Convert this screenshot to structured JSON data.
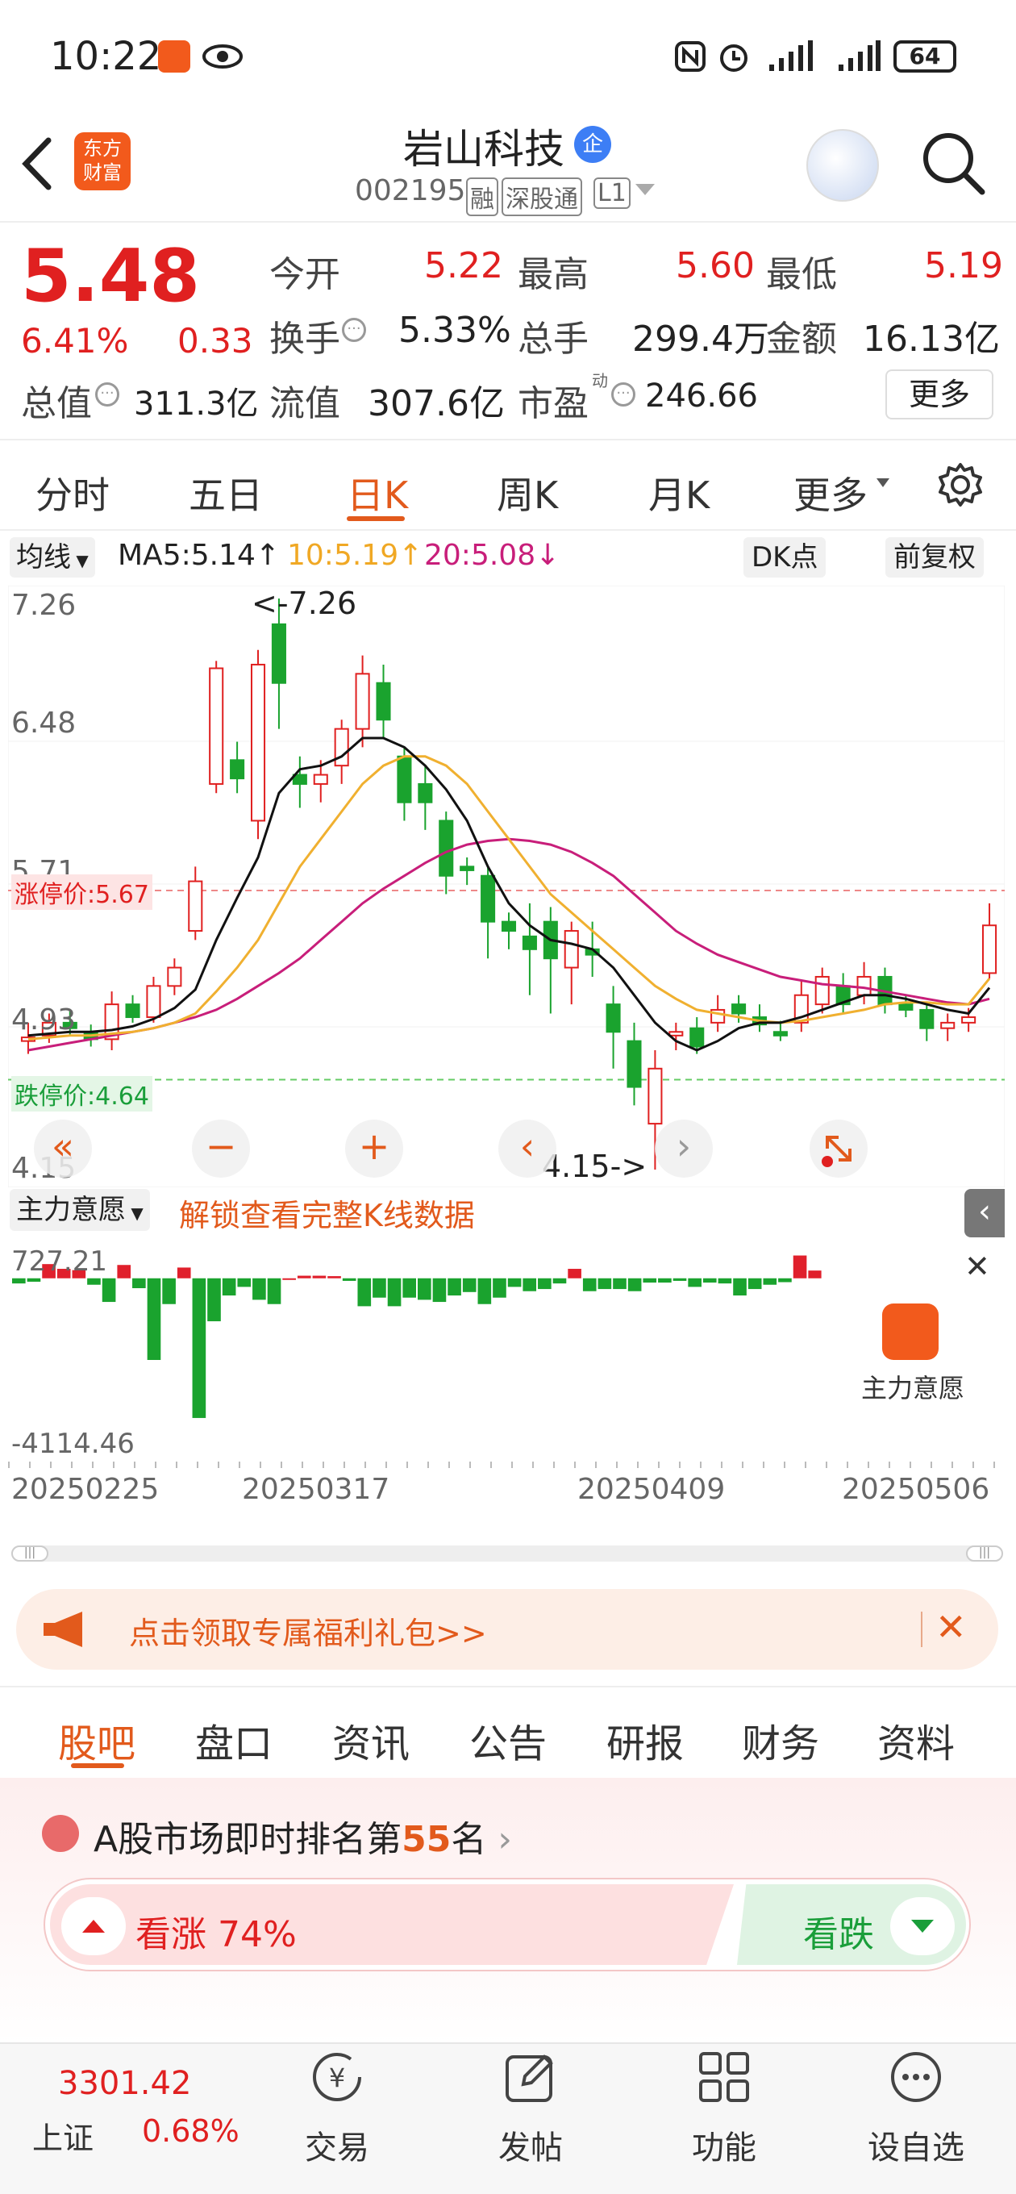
{
  "status": {
    "time": "10:22",
    "battery": "64"
  },
  "header": {
    "logo_line1": "东方",
    "logo_line2": "财富",
    "name": "岩山科技",
    "name_badge": "企",
    "code": "002195",
    "tags": [
      "融",
      "深股通",
      "L1"
    ]
  },
  "quote": {
    "price": "5.48",
    "change_pct": "6.41%",
    "change_amt": "0.33",
    "items": [
      {
        "label": "今开",
        "value": "5.22"
      },
      {
        "label": "最高",
        "value": "5.60"
      },
      {
        "label": "最低",
        "value": "5.19"
      },
      {
        "label": "换手",
        "value": "5.33%"
      },
      {
        "label": "总手",
        "value": "299.4万"
      },
      {
        "label": "金额",
        "value": "16.13亿"
      },
      {
        "label": "总值",
        "value": "311.3亿"
      },
      {
        "label": "流值",
        "value": "307.6亿"
      },
      {
        "label": "市盈",
        "value": "246.66"
      }
    ],
    "pe_sup": "动",
    "more": "更多"
  },
  "tabs": [
    "分时",
    "五日",
    "日K",
    "周K",
    "月K",
    "更多"
  ],
  "active_tab": "日K",
  "chart_toolbar": {
    "ma_select": "均线",
    "ma5": "MA5:5.14",
    "ma10": "10:5.19",
    "ma20": "20:5.08",
    "dk": "DK点",
    "fq": "前复权"
  },
  "chart_data": {
    "type": "candlestick",
    "ylim": [
      4.15,
      7.26
    ],
    "y_ticks": [
      "7.26",
      "6.48",
      "5.71",
      "4.93",
      "4.15"
    ],
    "limit_up_label": "涨停价:5.67",
    "limit_up": 5.67,
    "limit_down_label": "跌停价:4.64",
    "limit_down": 4.64,
    "high_annotation": "<-7.26",
    "low_annotation": "4.15->",
    "candles": [
      {
        "o": 4.85,
        "c": 4.87,
        "h": 4.95,
        "l": 4.78
      },
      {
        "o": 4.88,
        "c": 4.95,
        "h": 5.0,
        "l": 4.84
      },
      {
        "o": 4.95,
        "c": 4.92,
        "h": 5.02,
        "l": 4.88
      },
      {
        "o": 4.9,
        "c": 4.86,
        "h": 4.94,
        "l": 4.82
      },
      {
        "o": 4.86,
        "c": 5.05,
        "h": 5.12,
        "l": 4.8
      },
      {
        "o": 5.05,
        "c": 4.98,
        "h": 5.1,
        "l": 4.95
      },
      {
        "o": 4.98,
        "c": 5.15,
        "h": 5.2,
        "l": 4.95
      },
      {
        "o": 5.15,
        "c": 5.25,
        "h": 5.3,
        "l": 5.1
      },
      {
        "o": 5.45,
        "c": 5.72,
        "h": 5.8,
        "l": 5.4
      },
      {
        "o": 6.25,
        "c": 6.88,
        "h": 6.92,
        "l": 6.2
      },
      {
        "o": 6.38,
        "c": 6.28,
        "h": 6.48,
        "l": 6.2
      },
      {
        "o": 6.05,
        "c": 6.9,
        "h": 6.98,
        "l": 5.95
      },
      {
        "o": 7.12,
        "c": 6.8,
        "h": 7.26,
        "l": 6.55
      },
      {
        "o": 6.3,
        "c": 6.25,
        "h": 6.4,
        "l": 6.12
      },
      {
        "o": 6.25,
        "c": 6.3,
        "h": 6.38,
        "l": 6.15
      },
      {
        "o": 6.35,
        "c": 6.55,
        "h": 6.6,
        "l": 6.25
      },
      {
        "o": 6.55,
        "c": 6.85,
        "h": 6.95,
        "l": 6.45
      },
      {
        "o": 6.8,
        "c": 6.6,
        "h": 6.9,
        "l": 6.5
      },
      {
        "o": 6.4,
        "c": 6.15,
        "h": 6.45,
        "l": 6.05
      },
      {
        "o": 6.25,
        "c": 6.15,
        "h": 6.35,
        "l": 6.0
      },
      {
        "o": 6.05,
        "c": 5.75,
        "h": 6.1,
        "l": 5.65
      },
      {
        "o": 5.8,
        "c": 5.78,
        "h": 5.85,
        "l": 5.7
      },
      {
        "o": 5.75,
        "c": 5.5,
        "h": 5.8,
        "l": 5.3
      },
      {
        "o": 5.5,
        "c": 5.45,
        "h": 5.55,
        "l": 5.35
      },
      {
        "o": 5.42,
        "c": 5.35,
        "h": 5.6,
        "l": 5.1
      },
      {
        "o": 5.5,
        "c": 5.3,
        "h": 5.58,
        "l": 5.0
      },
      {
        "o": 5.25,
        "c": 5.45,
        "h": 5.5,
        "l": 5.05
      },
      {
        "o": 5.35,
        "c": 5.32,
        "h": 5.5,
        "l": 5.2
      },
      {
        "o": 5.05,
        "c": 4.9,
        "h": 5.15,
        "l": 4.7
      },
      {
        "o": 4.85,
        "c": 4.6,
        "h": 4.95,
        "l": 4.5
      },
      {
        "o": 4.4,
        "c": 4.7,
        "h": 4.8,
        "l": 4.15
      },
      {
        "o": 4.88,
        "c": 4.9,
        "h": 4.95,
        "l": 4.8
      },
      {
        "o": 4.92,
        "c": 4.82,
        "h": 4.98,
        "l": 4.78
      },
      {
        "o": 4.95,
        "c": 5.02,
        "h": 5.1,
        "l": 4.9
      },
      {
        "o": 5.05,
        "c": 5.0,
        "h": 5.1,
        "l": 4.95
      },
      {
        "o": 4.98,
        "c": 4.94,
        "h": 5.05,
        "l": 4.9
      },
      {
        "o": 4.9,
        "c": 4.88,
        "h": 4.96,
        "l": 4.85
      },
      {
        "o": 4.95,
        "c": 5.1,
        "h": 5.18,
        "l": 4.9
      },
      {
        "o": 5.05,
        "c": 5.2,
        "h": 5.25,
        "l": 5.0
      },
      {
        "o": 5.15,
        "c": 5.05,
        "h": 5.22,
        "l": 5.0
      },
      {
        "o": 5.1,
        "c": 5.2,
        "h": 5.28,
        "l": 5.05
      },
      {
        "o": 5.2,
        "c": 5.05,
        "h": 5.25,
        "l": 5.0
      },
      {
        "o": 5.05,
        "c": 5.02,
        "h": 5.1,
        "l": 4.98
      },
      {
        "o": 5.02,
        "c": 4.92,
        "h": 5.05,
        "l": 4.85
      },
      {
        "o": 4.92,
        "c": 4.95,
        "h": 5.0,
        "l": 4.85
      },
      {
        "o": 4.95,
        "c": 4.98,
        "h": 5.03,
        "l": 4.9
      },
      {
        "o": 5.22,
        "c": 5.48,
        "h": 5.6,
        "l": 5.19
      }
    ],
    "ma5": [
      4.88,
      4.89,
      4.9,
      4.9,
      4.91,
      4.93,
      4.97,
      5.03,
      5.13,
      5.4,
      5.63,
      5.85,
      6.2,
      6.33,
      6.35,
      6.4,
      6.5,
      6.5,
      6.45,
      6.35,
      6.22,
      6.05,
      5.8,
      5.6,
      5.48,
      5.4,
      5.38,
      5.35,
      5.25,
      5.1,
      4.95,
      4.85,
      4.8,
      4.85,
      4.92,
      4.95,
      4.95,
      4.98,
      5.02,
      5.06,
      5.1,
      5.1,
      5.08,
      5.05,
      5.02,
      5.0,
      5.14
    ],
    "ma10": [
      4.86,
      4.87,
      4.88,
      4.88,
      4.89,
      4.9,
      4.92,
      4.95,
      5.0,
      5.12,
      5.25,
      5.4,
      5.6,
      5.8,
      5.95,
      6.1,
      6.25,
      6.35,
      6.4,
      6.4,
      6.35,
      6.25,
      6.1,
      5.95,
      5.8,
      5.65,
      5.55,
      5.45,
      5.35,
      5.25,
      5.15,
      5.08,
      5.02,
      5.0,
      4.98,
      4.96,
      4.95,
      4.96,
      4.98,
      5.0,
      5.02,
      5.05,
      5.06,
      5.06,
      5.05,
      5.05,
      5.19
    ],
    "ma20": [
      4.8,
      4.82,
      4.84,
      4.86,
      4.88,
      4.9,
      4.92,
      4.95,
      4.98,
      5.02,
      5.08,
      5.15,
      5.22,
      5.3,
      5.4,
      5.5,
      5.6,
      5.68,
      5.75,
      5.82,
      5.88,
      5.92,
      5.94,
      5.95,
      5.94,
      5.92,
      5.88,
      5.82,
      5.75,
      5.65,
      5.55,
      5.45,
      5.38,
      5.32,
      5.28,
      5.24,
      5.2,
      5.18,
      5.16,
      5.15,
      5.14,
      5.12,
      5.1,
      5.08,
      5.06,
      5.05,
      5.08
    ]
  },
  "chart_controls": {
    "first": "«",
    "zoom_out": "−",
    "zoom_in": "+",
    "prev": "‹",
    "next": "›"
  },
  "indicator": {
    "select": "主力意愿",
    "unlock": "解锁查看完整K线数据",
    "top": "727.21",
    "bottom": "-4114.46",
    "overlay_label": "主力意愿",
    "values": [
      -120,
      -80,
      330,
      220,
      190,
      -150,
      -550,
      310,
      -230,
      -1900,
      -600,
      250,
      -3250,
      -1000,
      -400,
      -200,
      -500,
      -600,
      0,
      60,
      60,
      50,
      -60,
      -650,
      -450,
      -650,
      -450,
      -500,
      -550,
      -400,
      -320,
      -600,
      -450,
      -200,
      -300,
      -250,
      -120,
      220,
      -300,
      -250,
      -250,
      -300,
      -100,
      -100,
      -60,
      -200,
      -100,
      -120,
      -400,
      -250,
      -150,
      -90,
      530,
      180
    ]
  },
  "dates": [
    "20250225",
    "20250317",
    "20250409",
    "20250506"
  ],
  "banner": {
    "text": "点击领取专属福利礼包>>"
  },
  "bottom_tabs": [
    "股吧",
    "盘口",
    "资讯",
    "公告",
    "研报",
    "财务",
    "资料"
  ],
  "active_bottom_tab": "股吧",
  "ranking": {
    "prefix": "A股市场即时排名第",
    "rank": "55",
    "suffix": "名"
  },
  "sentiment": {
    "bull_label": "看涨",
    "bull_pct": "74%",
    "bear_label": "看跌",
    "bull_ratio": 0.74
  },
  "nav": {
    "index_value": "3301.42",
    "index_name": "上证",
    "index_pct": "0.68%",
    "items": [
      "交易",
      "发帖",
      "功能",
      "设自选"
    ]
  }
}
